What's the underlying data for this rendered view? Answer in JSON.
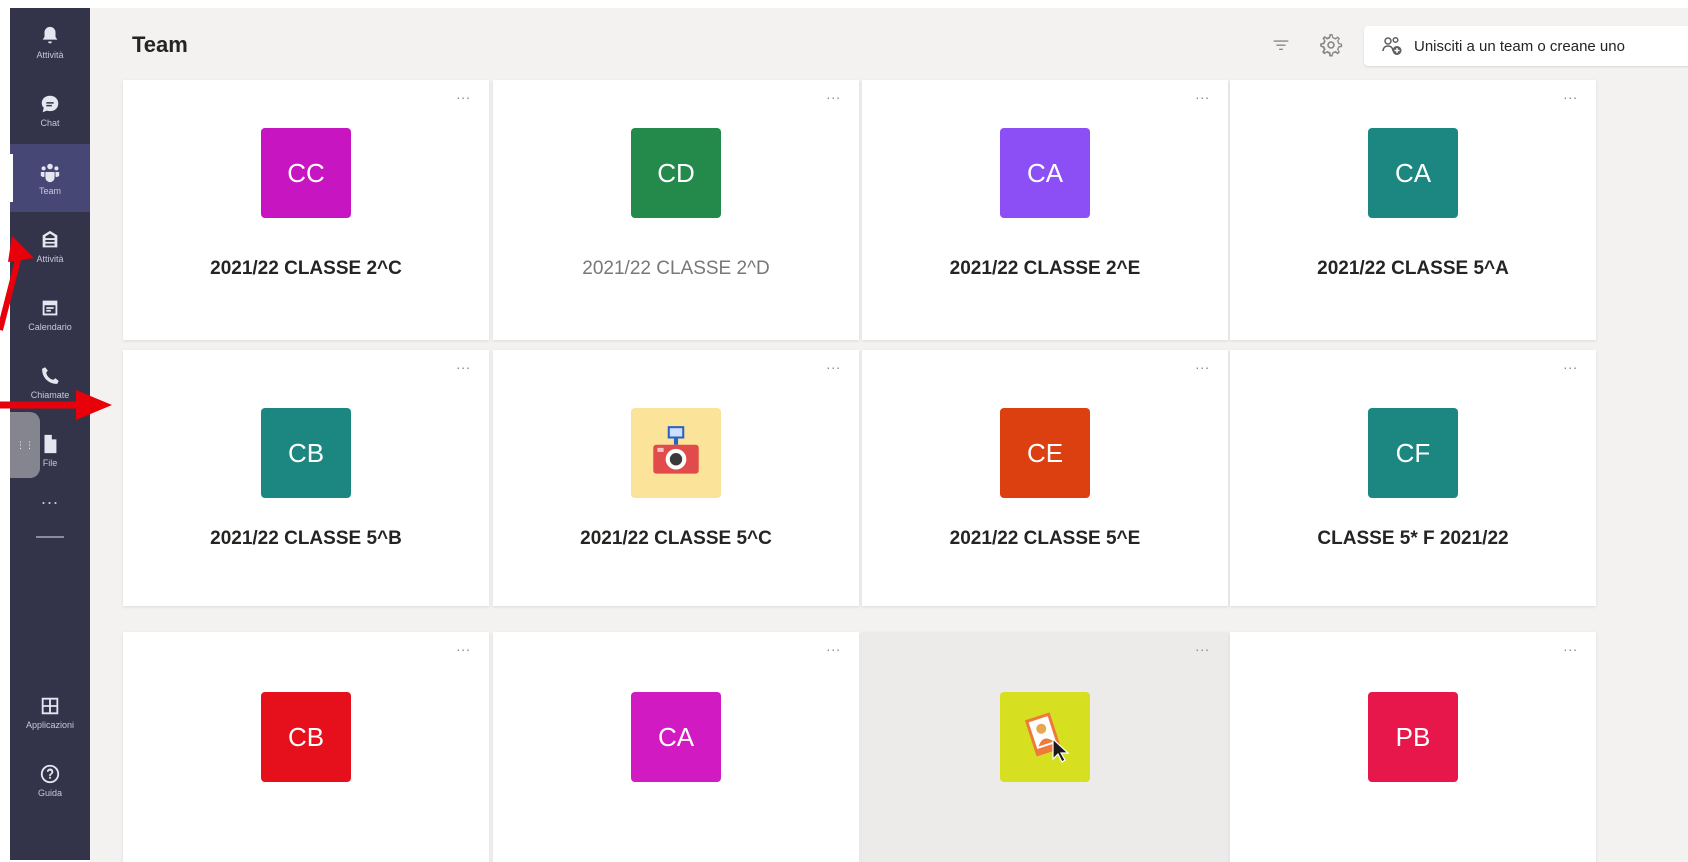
{
  "rail": {
    "items": [
      {
        "label": "Attività",
        "icon": "bell-icon"
      },
      {
        "label": "Chat",
        "icon": "chat-icon"
      },
      {
        "label": "Team",
        "icon": "team-icon"
      },
      {
        "label": "Attività",
        "icon": "assignments-icon"
      },
      {
        "label": "Calendario",
        "icon": "calendar-icon"
      },
      {
        "label": "Chiamate",
        "icon": "phone-icon"
      },
      {
        "label": "File",
        "icon": "file-icon"
      }
    ],
    "more": "...",
    "apps_label": "Applicazioni",
    "help_label": "Guida"
  },
  "header": {
    "title": "Team",
    "join_label": "Unisciti a un team o creane uno"
  },
  "teams": [
    {
      "initials": "CC",
      "name": "2021/22 CLASSE 2^C",
      "color": "#c715c2"
    },
    {
      "initials": "CD",
      "name": "2021/22 CLASSE 2^D",
      "color": "#238a4c"
    },
    {
      "initials": "CA",
      "name": "2021/22 CLASSE 2^E",
      "color": "#8c4ff5"
    },
    {
      "initials": "CA",
      "name": "2021/22 CLASSE 5^A",
      "color": "#1c8781"
    },
    {
      "initials": "CB",
      "name": "2021/22 CLASSE 5^B",
      "color": "#1c8781"
    },
    {
      "initials": "",
      "name": "2021/22 CLASSE 5^C",
      "color": "#fbe39a",
      "icon": "camera-icon"
    },
    {
      "initials": "CE",
      "name": "2021/22 CLASSE 5^E",
      "color": "#dc3f10"
    },
    {
      "initials": "CF",
      "name": "CLASSE 5* F 2021/22",
      "color": "#1c8781"
    },
    {
      "initials": "CB",
      "name": "",
      "color": "#e60f1c"
    },
    {
      "initials": "CA",
      "name": "",
      "color": "#d11ac2"
    },
    {
      "initials": "",
      "name": "",
      "color": "#d6e021",
      "icon": "photo-icon"
    },
    {
      "initials": "PB",
      "name": "",
      "color": "#e8174b"
    }
  ],
  "more_label": "..."
}
